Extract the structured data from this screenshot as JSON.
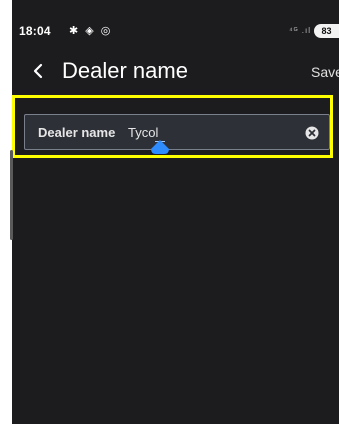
{
  "status_bar": {
    "time": "18:04",
    "left_icons": "✱ ◈ ◎",
    "right_icons": "⁴ᴳ .ıl",
    "battery": "83"
  },
  "top_bar": {
    "title": "Dealer name",
    "save_label": "Save"
  },
  "field": {
    "label": "Dealer name",
    "value": "Tycol"
  },
  "colors": {
    "background": "#1c1c1e",
    "field_background": "#2e3038",
    "highlight": "#ffff00",
    "cursor_handle": "#2f8cff"
  },
  "icons": {
    "back": "chevron-left-icon",
    "clear": "clear-circle-icon",
    "cursor": "text-cursor-handle-icon"
  }
}
